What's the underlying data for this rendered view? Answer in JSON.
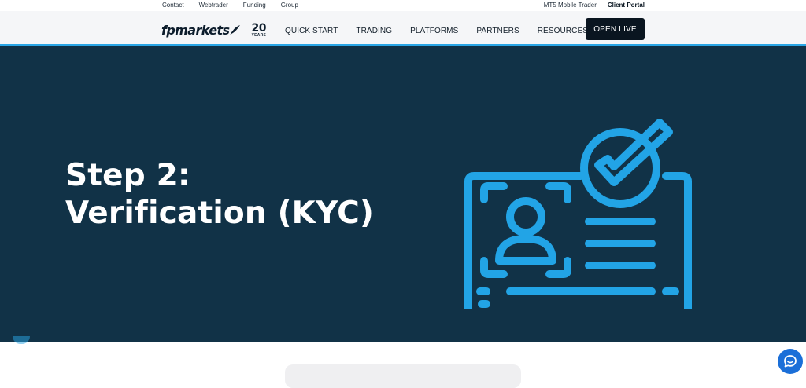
{
  "topbar": {
    "left_links": [
      "Contact",
      "Webtrader",
      "Funding",
      "Group"
    ],
    "right_links": [
      "MT5 Mobile Trader"
    ],
    "client_portal": "Client Portal"
  },
  "logo": {
    "brand": "fpmarkets",
    "anniversary_number": "20",
    "anniversary_label": "YEARS"
  },
  "nav": {
    "items": [
      "QUICK START",
      "TRADING",
      "PLATFORMS",
      "PARTNERS",
      "RESOURCES"
    ],
    "cta_label": "OPEN LIVE"
  },
  "hero": {
    "title": "Step 2: Verification (KYC)",
    "illustration": "monitor-id-verification-check-icon"
  },
  "colors": {
    "hero_bg": "#113247",
    "accent": "#2aa6e6",
    "cta_bg": "#0a1520",
    "chat_button": "#1b6fd8"
  },
  "chat": {
    "icon": "chat-bubble-icon"
  }
}
